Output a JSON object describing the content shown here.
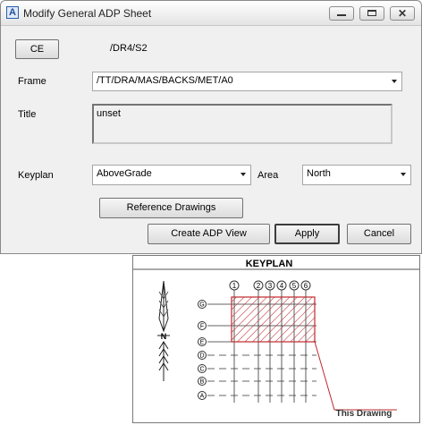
{
  "window": {
    "title": "Modify General ADP Sheet",
    "app_icon": "A"
  },
  "form": {
    "ce_button": "CE",
    "ce_value": "/DR4/S2",
    "frame_label": "Frame",
    "frame_value": "/TT/DRA/MAS/BACKS/MET/A0",
    "title_label": "Title",
    "title_value": "unset",
    "keyplan_label": "Keyplan",
    "keyplan_value": "AboveGrade",
    "area_label": "Area",
    "area_value": "North",
    "reference_button": "Reference Drawings"
  },
  "actions": {
    "create": "Create ADP View",
    "apply": "Apply",
    "cancel": "Cancel"
  },
  "keyplan": {
    "heading": "KEYPLAN",
    "north": "N",
    "columns": [
      "1",
      "2",
      "3",
      "4",
      "5",
      "6"
    ],
    "rows": [
      "G",
      "F",
      "E",
      "D",
      "C",
      "B",
      "A"
    ],
    "callout": "This Drawing",
    "highlight_color": "#c0282d"
  }
}
